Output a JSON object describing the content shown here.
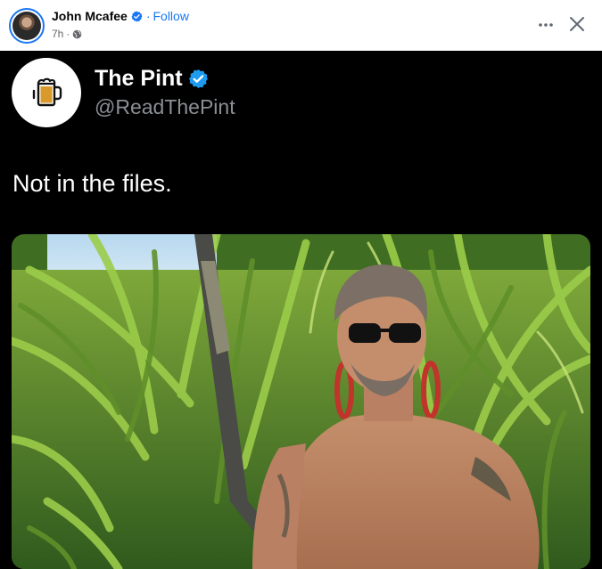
{
  "post_header": {
    "author_name": "John Mcafee",
    "separator": "·",
    "follow_label": "Follow",
    "timestamp": "7h",
    "meta_separator": "·",
    "privacy_icon": "globe-icon",
    "verified_icon": "verified-badge-icon",
    "more_icon": "more-options-icon",
    "close_icon": "close-icon"
  },
  "tweet": {
    "avatar_icon": "beer-mug-icon",
    "name": "The Pint",
    "handle": "@ReadThePint",
    "text": "Not in the files.",
    "verified_icon": "verified-badge-icon"
  },
  "colors": {
    "facebook_blue": "#1877f2",
    "tweet_background": "#000000",
    "tweet_handle": "#8b8f94",
    "beer_amber": "#d99a2b"
  }
}
